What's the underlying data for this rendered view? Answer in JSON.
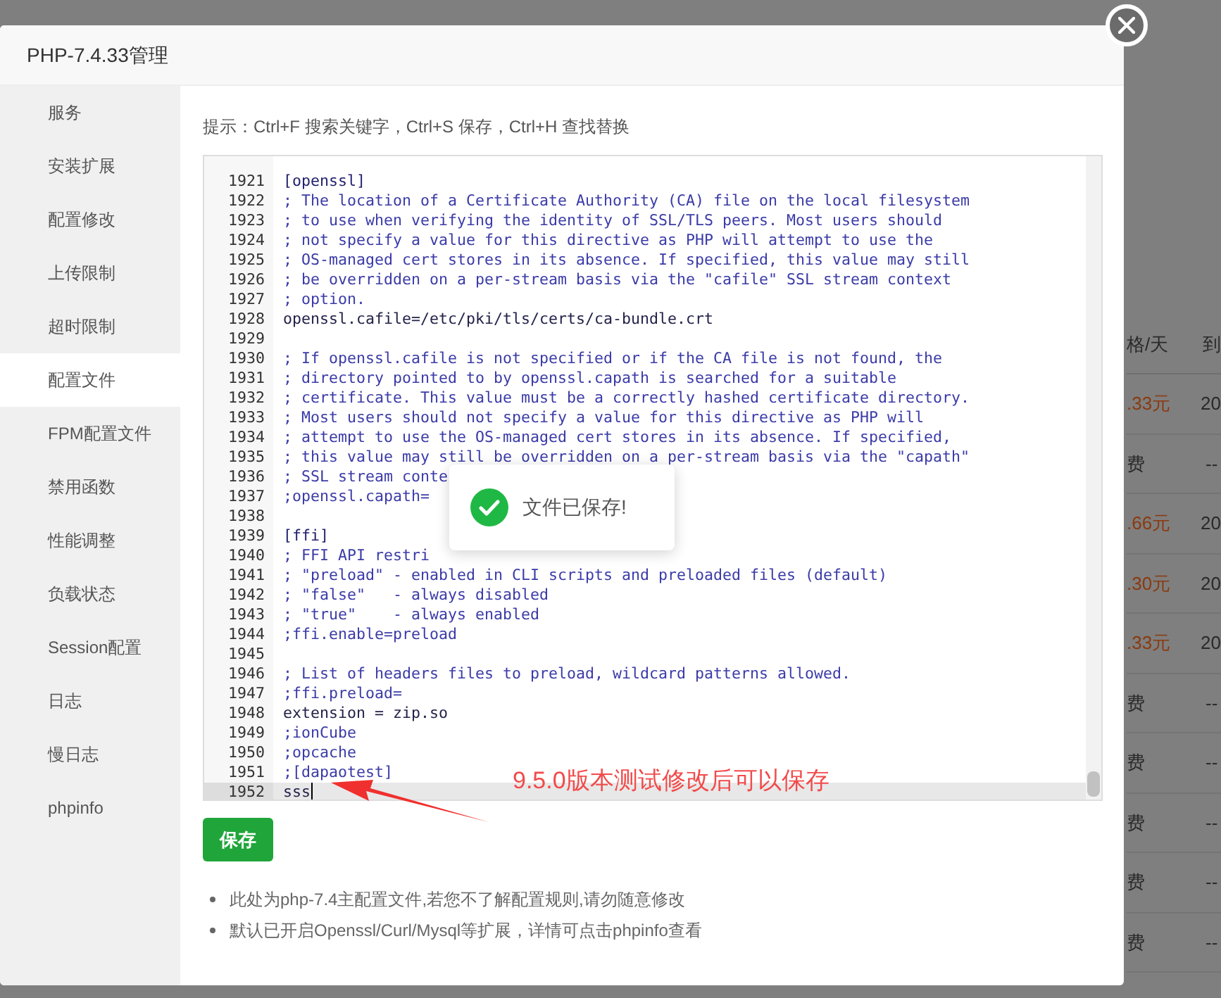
{
  "dialog": {
    "title": "PHP-7.4.33管理"
  },
  "sidebar": {
    "items": [
      {
        "label": "服务",
        "selected": false
      },
      {
        "label": "安装扩展",
        "selected": false
      },
      {
        "label": "配置修改",
        "selected": false
      },
      {
        "label": "上传限制",
        "selected": false
      },
      {
        "label": "超时限制",
        "selected": false
      },
      {
        "label": "配置文件",
        "selected": true
      },
      {
        "label": "FPM配置文件",
        "selected": false
      },
      {
        "label": "禁用函数",
        "selected": false
      },
      {
        "label": "性能调整",
        "selected": false
      },
      {
        "label": "负载状态",
        "selected": false
      },
      {
        "label": "Session配置",
        "selected": false
      },
      {
        "label": "日志",
        "selected": false
      },
      {
        "label": "慢日志",
        "selected": false
      },
      {
        "label": "phpinfo",
        "selected": false
      }
    ]
  },
  "hint": "提示：Ctrl+F 搜索关键字，Ctrl+S 保存，Ctrl+H 查找替换",
  "editor": {
    "lines": [
      {
        "number": "1921",
        "text": "[openssl]",
        "kind": "section",
        "current": false
      },
      {
        "number": "1922",
        "text": "; The location of a Certificate Authority (CA) file on the local filesystem",
        "kind": "comment",
        "current": false
      },
      {
        "number": "1923",
        "text": "; to use when verifying the identity of SSL/TLS peers. Most users should",
        "kind": "comment",
        "current": false
      },
      {
        "number": "1924",
        "text": "; not specify a value for this directive as PHP will attempt to use the",
        "kind": "comment",
        "current": false
      },
      {
        "number": "1925",
        "text": "; OS-managed cert stores in its absence. If specified, this value may still",
        "kind": "comment",
        "current": false
      },
      {
        "number": "1926",
        "text": "; be overridden on a per-stream basis via the \"cafile\" SSL stream context",
        "kind": "comment",
        "current": false
      },
      {
        "number": "1927",
        "text": "; option.",
        "kind": "comment",
        "current": false
      },
      {
        "number": "1928",
        "text": "openssl.cafile=/etc/pki/tls/certs/ca-bundle.crt",
        "kind": "code",
        "current": false
      },
      {
        "number": "1929",
        "current": false
      },
      {
        "number": "1930",
        "text": "; If openssl.cafile is not specified or if the CA file is not found, the",
        "kind": "comment",
        "current": false
      },
      {
        "number": "1931",
        "text": "; directory pointed to by openssl.capath is searched for a suitable",
        "kind": "comment",
        "current": false
      },
      {
        "number": "1932",
        "text": "; certificate. This value must be a correctly hashed certificate directory.",
        "kind": "comment",
        "current": false
      },
      {
        "number": "1933",
        "text": "; Most users should not specify a value for this directive as PHP will",
        "kind": "comment",
        "current": false
      },
      {
        "number": "1934",
        "text": "; attempt to use the OS-managed cert stores in its absence. If specified,",
        "kind": "comment",
        "current": false
      },
      {
        "number": "1935",
        "text": "; this value may still be overridden on a per-stream basis via the \"capath\"",
        "kind": "comment",
        "current": false
      },
      {
        "number": "1936",
        "text": "; SSL stream conte",
        "kind": "comment",
        "current": false
      },
      {
        "number": "1937",
        "text": ";openssl.capath=",
        "kind": "comment",
        "current": false
      },
      {
        "number": "1938",
        "current": false
      },
      {
        "number": "1939",
        "text": "[ffi]",
        "kind": "section",
        "current": false
      },
      {
        "number": "1940",
        "text": "; FFI API restri",
        "kind": "comment",
        "current": false
      },
      {
        "number": "1941",
        "text": "; \"preload\" - enabled in CLI scripts and preloaded files (default)",
        "kind": "comment",
        "current": false
      },
      {
        "number": "1942",
        "text": "; \"false\"   - always disabled",
        "kind": "comment",
        "current": false
      },
      {
        "number": "1943",
        "text": "; \"true\"    - always enabled",
        "kind": "comment",
        "current": false
      },
      {
        "number": "1944",
        "text": ";ffi.enable=preload",
        "kind": "comment",
        "current": false
      },
      {
        "number": "1945",
        "current": false
      },
      {
        "number": "1946",
        "text": "; List of headers files to preload, wildcard patterns allowed.",
        "kind": "comment",
        "current": false
      },
      {
        "number": "1947",
        "text": ";ffi.preload=",
        "kind": "comment",
        "current": false
      },
      {
        "number": "1948",
        "text": "extension = zip.so",
        "kind": "code",
        "current": false
      },
      {
        "number": "1949",
        "text": ";ionCube",
        "kind": "comment",
        "current": false
      },
      {
        "number": "1950",
        "text": ";opcache",
        "kind": "comment",
        "current": false
      },
      {
        "number": "1951",
        "text": ";[dapaotest]",
        "kind": "comment",
        "current": false
      },
      {
        "number": "1952",
        "text": "sss",
        "kind": "code",
        "current": true
      }
    ]
  },
  "save_button": "保存",
  "notes": [
    "此处为php-7.4主配置文件,若您不了解配置规则,请勿随意修改",
    "默认已开启Openssl/Curl/Mysql等扩展，详情可点击phpinfo查看"
  ],
  "toast": {
    "message": "文件已保存!"
  },
  "annotation": "9.5.0版本测试修改后可以保存",
  "background_table": {
    "header": [
      "格/天",
      "到"
    ],
    "rows": [
      {
        "price": ".33元",
        "date": "20",
        "kind": "price"
      },
      {
        "price": "费",
        "date": "--",
        "kind": "free"
      },
      {
        "price": ".66元",
        "date": "20",
        "kind": "price"
      },
      {
        "price": ".30元",
        "date": "20",
        "kind": "price"
      },
      {
        "price": ".33元",
        "date": "20",
        "kind": "price"
      },
      {
        "price": "费",
        "date": "--",
        "kind": "free"
      },
      {
        "price": "费",
        "date": "--",
        "kind": "free"
      },
      {
        "price": "费",
        "date": "--",
        "kind": "free"
      },
      {
        "price": "费",
        "date": "--",
        "kind": "free"
      },
      {
        "price": "费",
        "date": "--",
        "kind": "free"
      }
    ]
  }
}
